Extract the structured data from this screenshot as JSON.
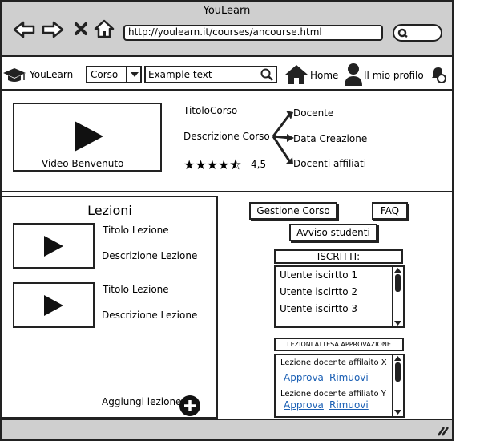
{
  "window": {
    "title": "YouLearn"
  },
  "browser": {
    "url": "http://youlearn.it/courses/ancourse.html"
  },
  "navbar": {
    "brand": "YouLearn",
    "select_value": "Corso",
    "search_value": "Example text",
    "home_label": "Home",
    "profile_label": "Il mio profilo"
  },
  "course": {
    "video_label": "Video Benvenuto",
    "title": "TitoloCorso",
    "description": "Descrizione Corso",
    "rating": "4,5",
    "rating_stars": 4.5,
    "links": [
      "Docente",
      "Data Creazione",
      "Docenti affiliati"
    ]
  },
  "lessons": {
    "heading": "Lezioni",
    "items": [
      {
        "title": "Titolo Lezione",
        "description": "Descrizione Lezione"
      },
      {
        "title": "Titolo Lezione",
        "description": "Descrizione Lezione"
      }
    ],
    "add_label": "Aggiungi lezione"
  },
  "actions": {
    "manage_course": "Gestione Corso",
    "faq": "FAQ",
    "notify_students": "Avviso studenti"
  },
  "enrolled": {
    "heading": "ISCRITTI:",
    "users": [
      "Utente iscirtto 1",
      "Utente iscirtto 2",
      "Utente iscirtto 3"
    ]
  },
  "pending": {
    "heading": "LEZIONI ATTESA APPROVAZIONE",
    "items": [
      {
        "text": "Lezione docente affilaito X",
        "approve": "Approva",
        "remove": "Rimuovi"
      },
      {
        "text": "Lezione docente affiliato Y",
        "approve": "Approva",
        "remove": "Rimuovi"
      }
    ]
  }
}
